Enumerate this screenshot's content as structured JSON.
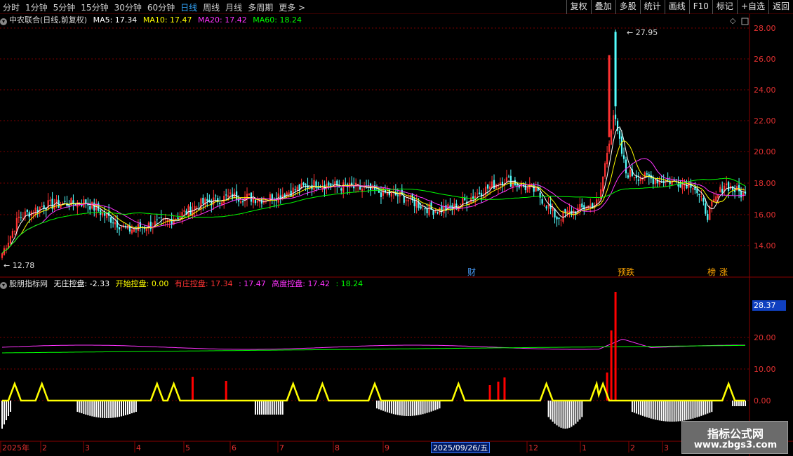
{
  "toolbar": {
    "periods": [
      "分时",
      "1分钟",
      "5分钟",
      "15分钟",
      "30分钟",
      "60分钟",
      "日线",
      "周线",
      "月线",
      "多周期",
      "更多 >"
    ],
    "active_period": "日线",
    "right_buttons": [
      "复权",
      "叠加",
      "多股",
      "统计",
      "画线",
      "F10",
      "标记",
      "+自选",
      "返回"
    ]
  },
  "main": {
    "title": "中农联合(日线,前复权)",
    "ma": [
      {
        "label": "MA5: 17.34",
        "color": "#ffffff"
      },
      {
        "label": "MA10: 17.47",
        "color": "#ffff00"
      },
      {
        "label": "MA20: 17.42",
        "color": "#ff33ff"
      },
      {
        "label": "MA60: 18.24",
        "color": "#00ff00"
      }
    ],
    "y_ticks": [
      "28.00",
      "26.00",
      "24.00",
      "22.00",
      "20.00",
      "18.00",
      "16.00",
      "14.00"
    ],
    "high_label": "27.95",
    "low_label": "12.78",
    "events": [
      {
        "text": "财",
        "color": "#4aa0ff"
      },
      {
        "text": "预跌",
        "color": "#ffa500"
      },
      {
        "text": "榜",
        "color": "#ffa500"
      },
      {
        "text": "涨",
        "color": "#ffa500"
      }
    ]
  },
  "sub": {
    "title": "股朋指标网",
    "items": [
      {
        "label": "无庄控盘: -2.33",
        "color": "#ffffff"
      },
      {
        "label": "开始控盘: 0.00",
        "color": "#ffff00"
      },
      {
        "label": "有庄控盘: 17.34",
        "color": "#ff3333"
      },
      {
        "label": ": 17.47",
        "color": "#ff33ff"
      },
      {
        "label": "高度控盘: 17.42",
        "color": "#ff33ff"
      },
      {
        "label": ": 18.24",
        "color": "#00ff00"
      }
    ],
    "y_ticks": [
      "20.00",
      "10.00",
      "0.00"
    ],
    "current_value": "28.37"
  },
  "x_axis": {
    "labels": [
      "2025年",
      "2",
      "3",
      "4",
      "5",
      "6",
      "7",
      "8",
      "9",
      "12",
      "1",
      "2",
      "3"
    ],
    "cursor_date": "2025/09/26/五"
  },
  "watermark": {
    "line1": "指标公式网",
    "line2": "www.zbgs3.com"
  },
  "colors": {
    "up": "#ff3232",
    "down": "#54ffff",
    "grid": "#7a0000"
  }
}
